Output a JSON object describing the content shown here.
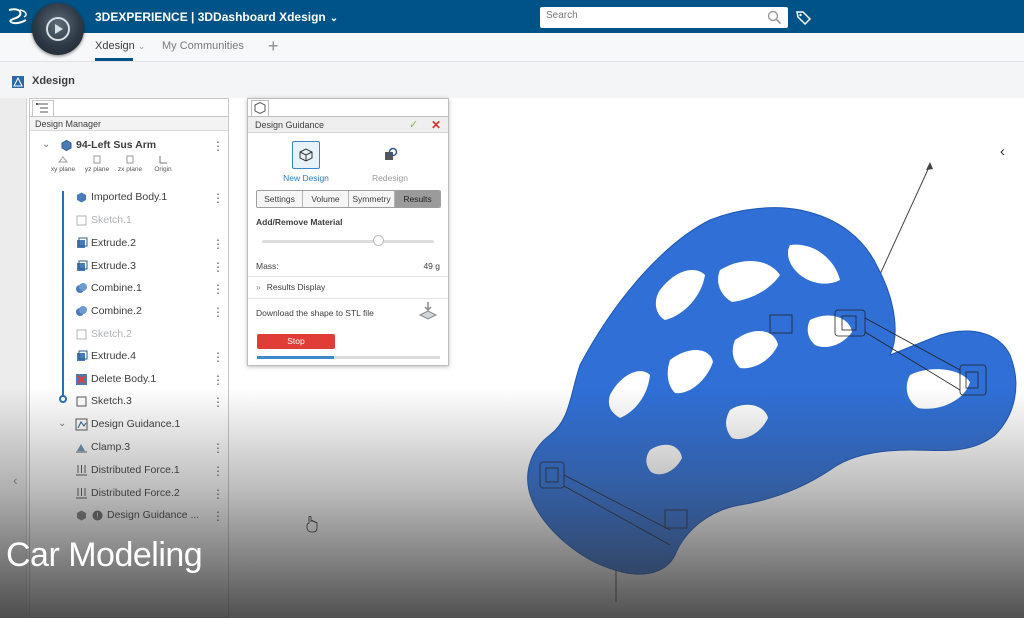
{
  "topbar": {
    "title": "3DEXPERIENCE | 3DDashboard Xdesign",
    "search_placeholder": "Search"
  },
  "tabs": [
    {
      "label": "Xdesign"
    },
    {
      "label": "My Communities"
    }
  ],
  "app": {
    "title": "Xdesign"
  },
  "design_manager": {
    "header": "Design Manager",
    "root": "94-Left Sus Arm",
    "planes": [
      "xy plane",
      "yz plane",
      "zx plane",
      "Origin"
    ],
    "items": [
      {
        "label": "Imported Body.1"
      },
      {
        "label": "Sketch.1"
      },
      {
        "label": "Extrude.2"
      },
      {
        "label": "Extrude.3"
      },
      {
        "label": "Combine.1"
      },
      {
        "label": "Combine.2"
      },
      {
        "label": "Sketch.2"
      },
      {
        "label": "Extrude.4"
      },
      {
        "label": "Delete Body.1"
      },
      {
        "label": "Sketch.3"
      },
      {
        "label": "Design Guidance.1"
      },
      {
        "label": "Clamp.3"
      },
      {
        "label": "Distributed Force.1"
      },
      {
        "label": "Distributed Force.2"
      },
      {
        "label": "Design Guidance ..."
      }
    ]
  },
  "design_guidance": {
    "title": "Design Guidance",
    "modes": [
      {
        "label": "New Design"
      },
      {
        "label": "Redesign"
      }
    ],
    "segments": [
      "Settings",
      "Volume",
      "Symmetry",
      "Results"
    ],
    "active_segment": "Results",
    "add_remove": "Add/Remove Material",
    "slider_value": 0.68,
    "mass_label": "Mass:",
    "mass_value": "49 g",
    "results_display": "Results Display",
    "download": "Download the shape to STL file",
    "stop": "Stop",
    "progress": 0.42
  },
  "caption": "Car Modeling",
  "colors": {
    "topbar": "#005386",
    "model": "#2f6fd6",
    "stop": "#e03d37",
    "accent": "#3f88c9"
  }
}
